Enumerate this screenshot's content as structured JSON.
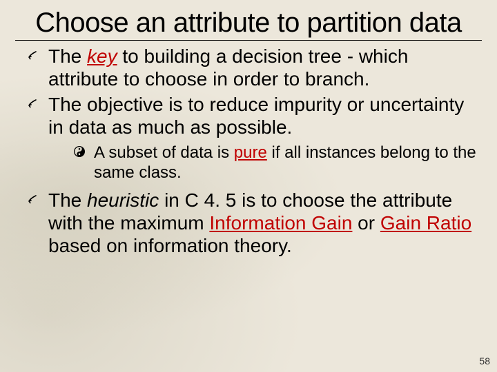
{
  "title": "Choose an attribute to partition data",
  "bullets": {
    "b1_a": "The ",
    "b1_key": "key",
    "b1_b": " to building a decision tree - which attribute to choose in order to branch.",
    "b2": "The objective is to reduce impurity or uncertainty in data as much as possible.",
    "b2_sub_a": "A subset of data is ",
    "b2_sub_pure": "pure",
    "b2_sub_b": " if all instances belong to the same class.",
    "b3_a": "The ",
    "b3_heur": "heuristic",
    "b3_b": " in C 4. 5 is to choose the attribute with the maximum ",
    "b3_ig": "Information Gain",
    "b3_c": " or ",
    "b3_gr": "Gain Ratio",
    "b3_d": " based on information theory."
  },
  "page_number": "58"
}
